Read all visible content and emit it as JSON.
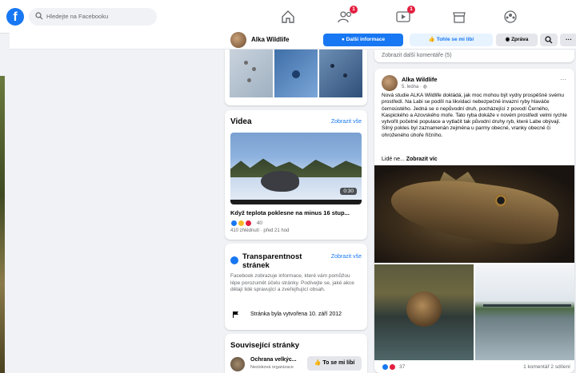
{
  "topbar": {
    "search_placeholder": "Hledejte na Facebooku",
    "friends_badge": "1",
    "watch_badge": "1"
  },
  "pagebar": {
    "page_name": "Alka Wildlife",
    "info_button": "Další informace",
    "like_button": "Tohle se mi líbí",
    "message_button": "Zpráva",
    "more_button": "···"
  },
  "videos": {
    "title": "Videa",
    "see_all": "Zobrazit vše",
    "duration": "0:30",
    "video_title": "Když teplota poklesne na minus 16 stup...",
    "reaction_count": "40",
    "meta": "410 zhlédnutí · před 21 hod"
  },
  "transparency": {
    "title": "Transparentnost stránek",
    "see_all": "Zobrazit vše",
    "body": "Facebook zobrazuje informace, které vám pomůžou lépe porozumět účelu stránky. Podívejte se, jaké akce dělají lidé spravující a zveřejňující obsah.",
    "created": "Stránka byla vytvořena 10. září 2012"
  },
  "related": {
    "title": "Související stránky",
    "page_name": "Ochrana velkýc...",
    "page_type": "Nezisková organizace",
    "like_button": "To se mi líbí"
  },
  "post": {
    "more_comments": "Zobrazit další komentáře (5)",
    "author": "Alka Wildlife",
    "date": "5. ledna · ",
    "text": "Nová studie ALKA Wildlife dokládá, jak moc mohou být vydry prospěšné svému prostředí. Na Labi se podílí na likvidaci nebezpečné invazní ryby hlaváče černoústého. Jedná se o nepůvodní druh, pocházející z povodí Černého, Kaspického a Azovského moře. Tato ryba dokáže v novém prostředí velmi rychle vytvořit početné populace a vytlačit tak původní druhy ryb, které Labe obývají. Silný pokles byl zaznamenán zejména u parmy obecné, vranky obecné či ohroženého úhoře říčního.",
    "read_more_prefix": "Lidé ne... ",
    "read_more": "Zobrazit víc",
    "reaction_count": "37",
    "footer_stats": "1 komentář  2 sdílení"
  }
}
